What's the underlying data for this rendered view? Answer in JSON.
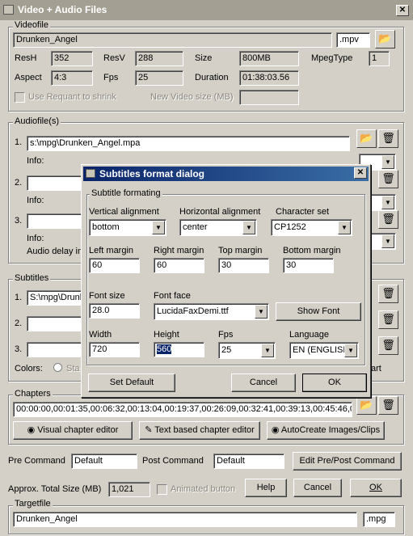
{
  "window": {
    "title": "Video + Audio Files"
  },
  "video": {
    "group": "Videofile",
    "name": "Drunken_Angel",
    "ext": ".mpv",
    "resh_label": "ResH",
    "resh": "352",
    "resv_label": "ResV",
    "resv": "288",
    "size_label": "Size",
    "size": "800MB",
    "mpegtype_label": "MpegType",
    "mpegtype": "1",
    "aspect_label": "Aspect",
    "aspect": "4:3",
    "fps_label": "Fps",
    "fps": "25",
    "duration_label": "Duration",
    "duration": "01:38:03.56",
    "requant_label": "Use Requant to shrink",
    "newsize_label": "New Video size (MB)"
  },
  "audio": {
    "group": "Audiofile(s)",
    "n1": "1.",
    "file1": "s:\\mpg\\Drunken_Angel.mpa",
    "info1": "Info:",
    "n2": "2.",
    "info2": "Info:",
    "n3": "3.",
    "info3": "Info:",
    "delay": "Audio delay in"
  },
  "subtitles": {
    "group": "Subtitles",
    "n1": "1.",
    "file1": "S:\\mpg\\Drunken_Angel",
    "n2": "2.",
    "n3": "3.",
    "colors": "Colors:",
    "st": "Sta",
    "art": "art"
  },
  "chapters": {
    "group": "Chapters",
    "value": "00:00:00,00:01:35,00:06:32,00:13:04,00:19:37,00:26:09,00:32:41,00:39:13,00:45:46,0",
    "visual": "Visual chapter editor",
    "text": "Text based chapter editor",
    "auto": "AutoCreate Images/Clips"
  },
  "commands": {
    "pre_label": "Pre Command",
    "pre": "Default",
    "post_label": "Post Command",
    "post": "Default",
    "edit": "Edit Pre/Post Command"
  },
  "bottom": {
    "total_label": "Approx. Total Size (MB)",
    "total": "1,021",
    "animated": "Animated button",
    "help": "Help",
    "cancel": "Cancel",
    "ok": "OK"
  },
  "target": {
    "group": "Targetfile",
    "name": "Drunken_Angel",
    "ext": ".mpg"
  },
  "dialog": {
    "title": "Subtitles format dialog",
    "group": "Subtitle formating",
    "valign_label": "Vertical alignment",
    "valign": "bottom",
    "halign_label": "Horizontal alignment",
    "halign": "center",
    "charset_label": "Character set",
    "charset": "CP1252",
    "left_label": "Left margin",
    "left": "60",
    "right_label": "Right margin",
    "right": "60",
    "top_label": "Top margin",
    "top": "30",
    "bottom_label": "Bottom margin",
    "bottom": "30",
    "fontsize_label": "Font size",
    "fontsize": "28.0",
    "fontface_label": "Font face",
    "fontface": "LucidaFaxDemi.ttf",
    "showfont": "Show Font",
    "width_label": "Width",
    "width": "720",
    "height_label": "Height",
    "height": "560",
    "fps_label": "Fps",
    "fps": "25",
    "lang_label": "Language",
    "lang": "EN (ENGLISH",
    "setdefault": "Set Default",
    "cancel": "Cancel",
    "ok": "OK"
  }
}
